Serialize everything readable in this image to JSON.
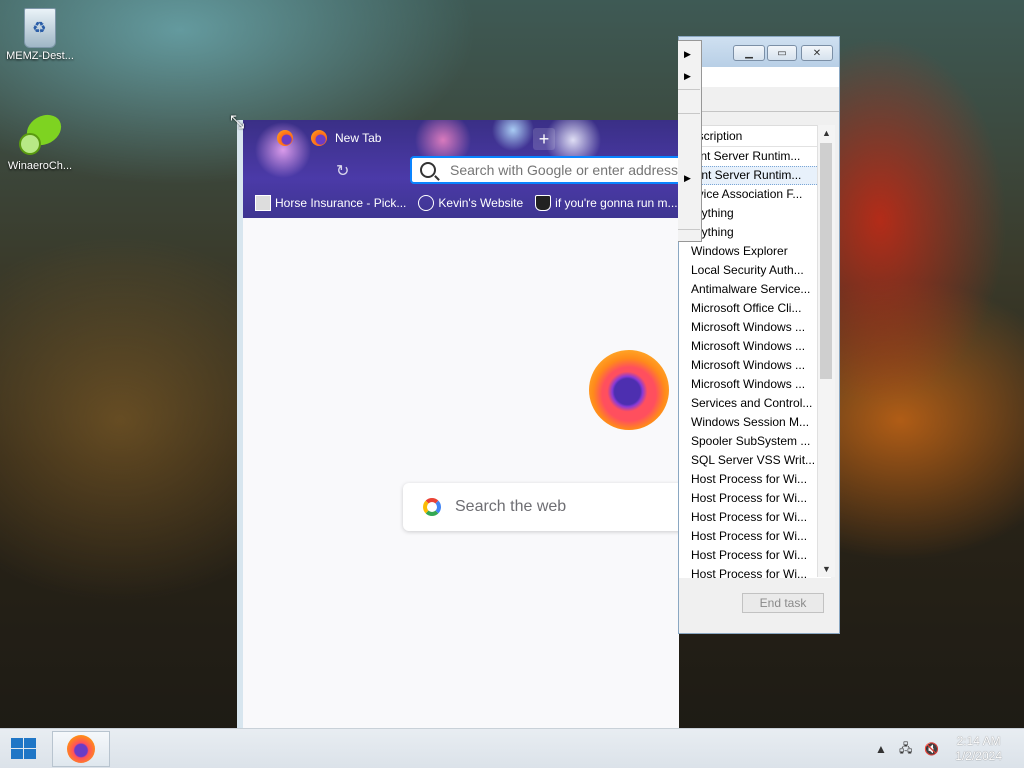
{
  "desktop": {
    "icons": [
      {
        "label": "MEMZ-Dest..."
      },
      {
        "label": "WinaeroCh..."
      }
    ]
  },
  "firefox": {
    "tab_label": "New Tab",
    "new_tab_symbol": "+",
    "url_placeholder": "Search with Google or enter address",
    "bookmarks": [
      {
        "label": "Horse Insurance - Pick..."
      },
      {
        "label": "Kevin's Website"
      },
      {
        "label": "if you're gonna run m..."
      }
    ],
    "search_placeholder": "Search the web"
  },
  "task_manager": {
    "column_header": "escription",
    "rows": [
      "ient Server Runtim...",
      "ient Server Runtim...",
      "evice Association F...",
      "erything",
      "erything",
      "Windows Explorer",
      "Local Security Auth...",
      "Antimalware Service...",
      "Microsoft Office Cli...",
      "Microsoft Windows ...",
      "Microsoft Windows ...",
      "Microsoft Windows ...",
      "Microsoft Windows ...",
      "Services and Control...",
      "Windows Session M...",
      "Spooler SubSystem ...",
      "SQL Server VSS Writ...",
      "Host Process for Wi...",
      "Host Process for Wi...",
      "Host Process for Wi...",
      "Host Process for Wi...",
      "Host Process for Wi...",
      "Host Process for Wi..."
    ],
    "selected_index": 1,
    "end_task_label": "End task"
  },
  "taskbar": {
    "time": "2:14 AM",
    "date": "1/2/2024"
  },
  "colors": {
    "accent": "#0a84ff",
    "taskbar": "#dbe2e9"
  }
}
